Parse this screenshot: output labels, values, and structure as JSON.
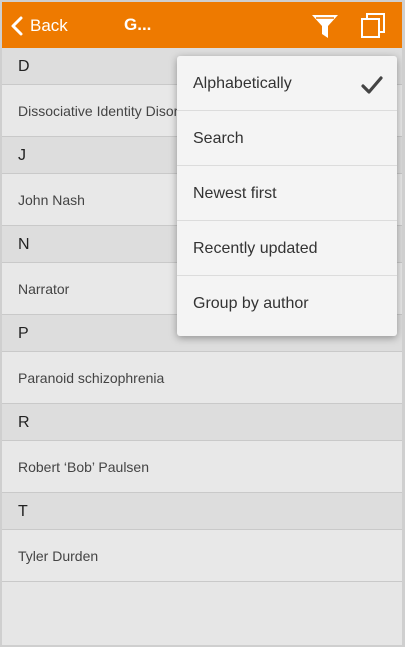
{
  "header": {
    "back_label": "Back",
    "title": "G...",
    "accent_color": "#ee7a00",
    "filter_icon": "funnel-icon",
    "copy_icon": "copy-icon"
  },
  "list": {
    "sections": [
      {
        "letter": "D",
        "items": [
          "Dissociative Identity Disorder"
        ]
      },
      {
        "letter": "J",
        "items": [
          "John Nash"
        ]
      },
      {
        "letter": "N",
        "items": [
          "Narrator"
        ]
      },
      {
        "letter": "P",
        "items": [
          "Paranoid schizophrenia"
        ]
      },
      {
        "letter": "R",
        "items": [
          "Robert ‘Bob’ Paulsen"
        ]
      },
      {
        "letter": "T",
        "items": [
          "Tyler Durden"
        ]
      }
    ]
  },
  "sort_menu": {
    "items": [
      {
        "label": "Alphabetically",
        "checked": true
      },
      {
        "label": "Search",
        "checked": false
      },
      {
        "label": "Newest first",
        "checked": false
      },
      {
        "label": "Recently updated",
        "checked": false
      },
      {
        "label": "Group by author",
        "checked": false
      }
    ]
  }
}
